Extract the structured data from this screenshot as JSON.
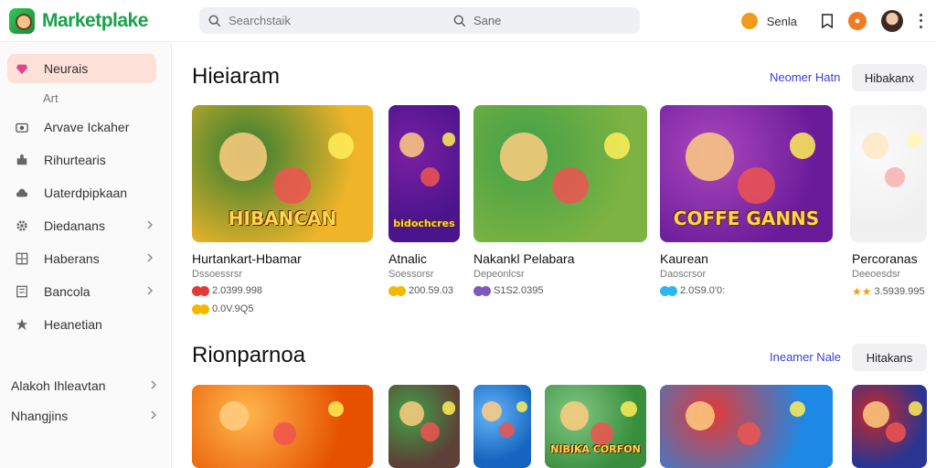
{
  "app": {
    "title": "Marketplake",
    "brand_color": "#18a24a",
    "accent": "#3a3fd6"
  },
  "search": {
    "placeholder": "Searchstaik",
    "secondary": "Sane"
  },
  "topbar": {
    "coin_label": "Senla"
  },
  "sidebar": {
    "items": [
      {
        "label": "Neurais",
        "icon": "gem-icon",
        "active": true
      },
      {
        "label": "Arvave Ickaher",
        "icon": "camera-icon"
      },
      {
        "label": "Rihurtearis",
        "icon": "puzzle-icon"
      },
      {
        "label": "Uaterdpipkaan",
        "icon": "cloud-icon"
      },
      {
        "label": "Diedanans",
        "icon": "gear-icon",
        "chevron": true
      },
      {
        "label": "Haberans",
        "icon": "grid-icon",
        "chevron": true
      },
      {
        "label": "Bancola",
        "icon": "book-icon",
        "chevron": true
      },
      {
        "label": "Heanetian",
        "icon": "star-icon"
      }
    ],
    "sub_label": "Art",
    "footer": [
      {
        "label": "Alakoh Ihleavtan",
        "chevron": true
      },
      {
        "label": "Nhangjins",
        "chevron": true
      }
    ]
  },
  "sections": [
    {
      "title": "Hieiaram",
      "link": "Neomer Hatn",
      "button": "Hibakanx",
      "cards": [
        {
          "title": "Hurtankart-Hbamar",
          "sub": "Dssoessrsr",
          "price": "2.0399.998",
          "price2": "0.0V.9Q5",
          "image_text": "HIBANCAN",
          "colors": [
            "#f0b429",
            "#2e7d32"
          ]
        },
        {
          "title": "Atnalic",
          "sub": "Soessorsr",
          "price": "200.59.03",
          "image_text": "bidochcres",
          "colors": [
            "#4a148c",
            "#7b1fa2"
          ]
        },
        {
          "title": "Nakankl Pelabara",
          "sub": "Depeonlcsr",
          "price": "S1S2.0395",
          "image_text": "",
          "colors": [
            "#7cb342",
            "#43a047"
          ]
        },
        {
          "title": "Kaurean",
          "sub": "Daoscrsor",
          "price": "2.0S9.0'0:",
          "image_text": "COFFE GANNS",
          "colors": [
            "#6a1b9a",
            "#ab47bc"
          ]
        },
        {
          "title": "Percoranas",
          "sub": "Deeoesdsr",
          "price": "3.5939.995",
          "image_text": "",
          "colors": [
            "#e0e0e0",
            "#f5f5f5"
          ]
        }
      ]
    },
    {
      "title": "Rionparnoa",
      "link": "Ineamer Nale",
      "button": "Hitakans",
      "cards": [
        {
          "image_text": "",
          "colors": [
            "#e65100",
            "#ffb74d"
          ]
        },
        {
          "image_text": "",
          "colors": [
            "#5d4037",
            "#43a047"
          ]
        },
        {
          "image_text": "",
          "colors": [
            "#1565c0",
            "#64b5f6"
          ]
        },
        {
          "image_text": "NIBIKA CORFON",
          "colors": [
            "#388e3c",
            "#81c784"
          ]
        },
        {
          "image_text": "",
          "colors": [
            "#1e88e5",
            "#e53935"
          ]
        },
        {
          "image_text": "",
          "colors": [
            "#283593",
            "#c62828"
          ]
        }
      ]
    }
  ]
}
